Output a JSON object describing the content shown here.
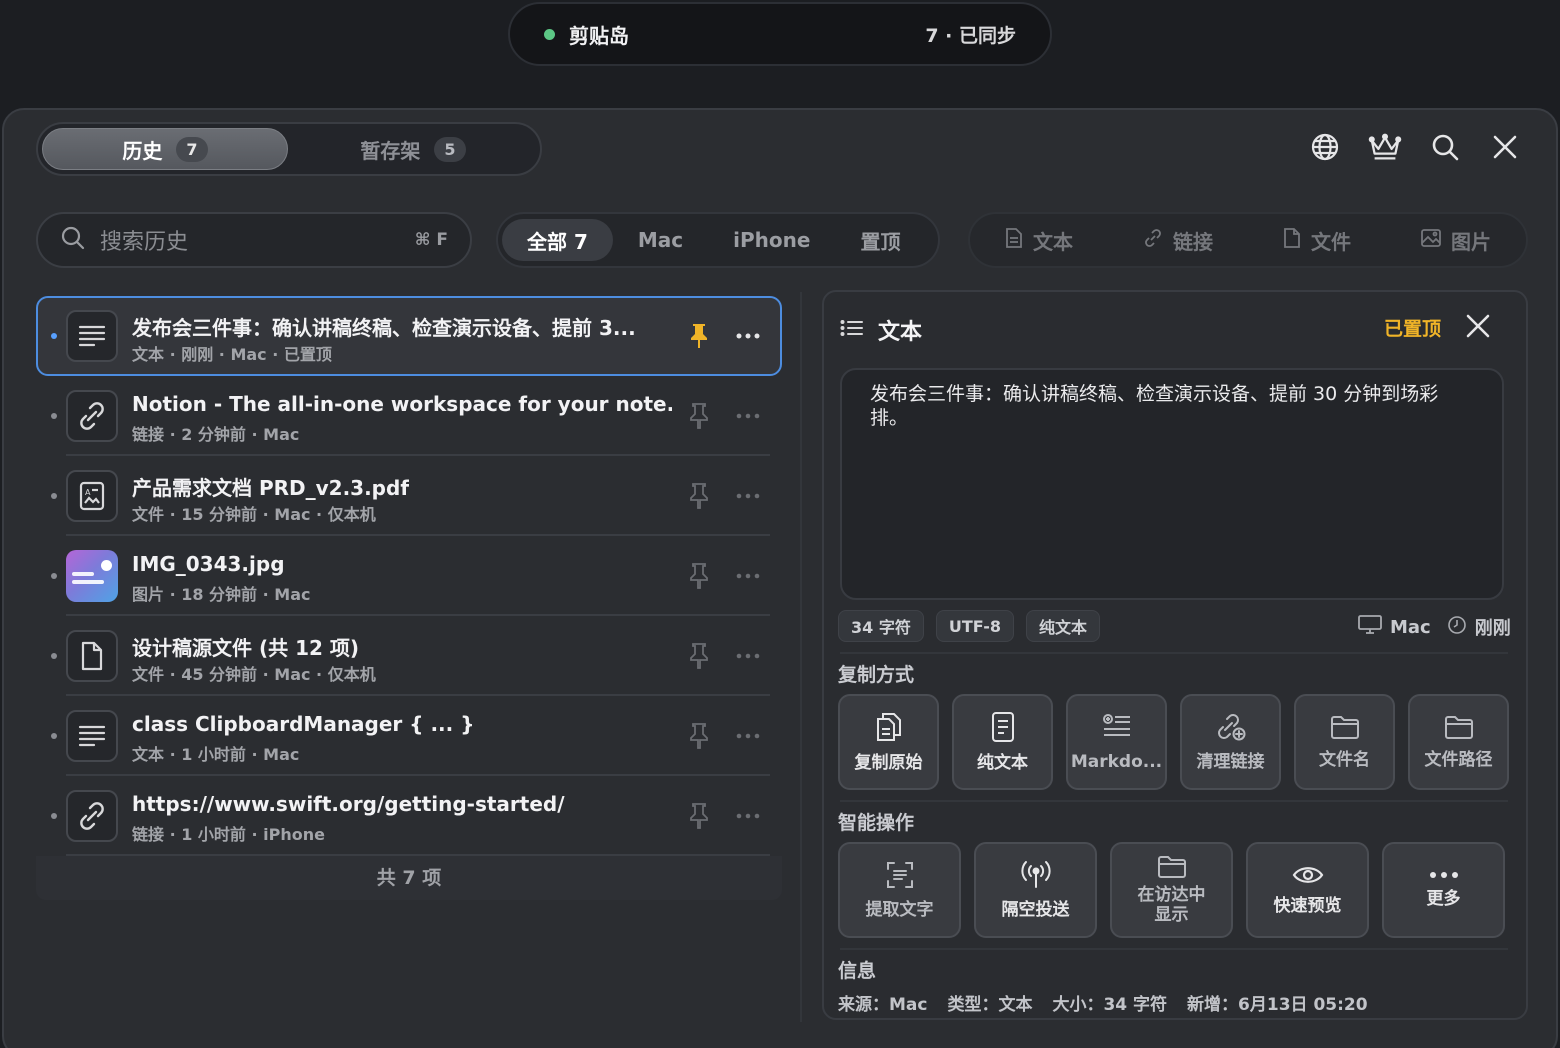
{
  "island": {
    "name": "剪贴岛",
    "status": "7 · 已同步"
  },
  "tabs": [
    {
      "label": "历史",
      "count": "7"
    },
    {
      "label": "暂存架",
      "count": "5"
    }
  ],
  "header_icons": [
    "globe-icon",
    "crown-icon",
    "search-icon",
    "close-icon"
  ],
  "search": {
    "placeholder": "搜索历史",
    "shortcut": "⌘ F"
  },
  "filters": [
    "全部 7",
    "Mac",
    "iPhone",
    "置顶"
  ],
  "types": [
    "文本",
    "链接",
    "文件",
    "图片"
  ],
  "items": [
    {
      "title": "发布会三件事：确认讲稿终稿、检查演示设备、提前 3...",
      "meta": "文本 · 刚刚 · Mac · 已置顶",
      "icon": "text-icon",
      "pinned": true
    },
    {
      "title": "Notion - The all-in-one workspace for your note...",
      "meta": "链接 · 2 分钟前 · Mac",
      "icon": "link-icon",
      "pinned": false
    },
    {
      "title": "产品需求文档 PRD_v2.3.pdf",
      "meta": "文件 · 15 分钟前 · Mac · 仅本机",
      "icon": "pdf-icon",
      "pinned": false
    },
    {
      "title": "IMG_0343.jpg",
      "meta": "图片 · 18 分钟前 · Mac",
      "icon": "image-thumbnail",
      "pinned": false
    },
    {
      "title": "设计稿源文件 (共 12 项)",
      "meta": "文件 · 45 分钟前 · Mac · 仅本机",
      "icon": "file-icon",
      "pinned": false
    },
    {
      "title": "class ClipboardManager { ... }",
      "meta": "文本 · 1 小时前 · Mac",
      "icon": "text-icon",
      "pinned": false
    },
    {
      "title": "https://www.swift.org/getting-started/",
      "meta": "链接 · 1 小时前 · iPhone",
      "icon": "link-icon",
      "pinned": false
    }
  ],
  "list_footer": "共 7 项",
  "detail": {
    "type": "文本",
    "pinned_label": "已置顶",
    "content": "发布会三件事：确认讲稿终稿、检查演示设备、提前 30 分钟到场彩排。",
    "chips": [
      "34 字符",
      "UTF-8",
      "纯文本"
    ],
    "device": "Mac",
    "time": "刚刚",
    "copy_section": "复制方式",
    "copy_actions": [
      "复制原始",
      "纯文本",
      "Markdo...",
      "清理链接",
      "文件名",
      "文件路径"
    ],
    "smart_section": "智能操作",
    "smart_actions": [
      "提取文字",
      "隔空投送",
      "在访达中\n显示",
      "快速预览",
      "更多"
    ],
    "info_section": "信息",
    "info": [
      "来源：Mac",
      "类型：文本",
      "大小：34 字符",
      "新增：6月13日 05:20"
    ]
  },
  "colors": {
    "accent": "#4d8de0",
    "pin": "#f0b428",
    "status_dot": "#5cc785"
  }
}
